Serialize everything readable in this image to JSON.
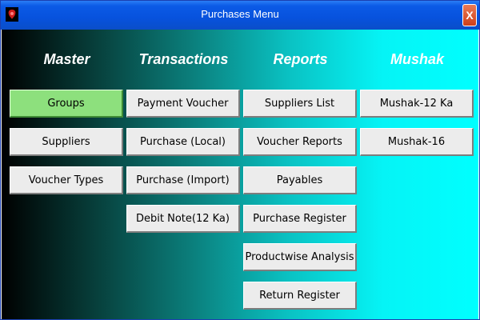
{
  "window": {
    "title": "Purchases Menu",
    "close_label": "X"
  },
  "columns": {
    "master": {
      "header": "Master",
      "items": [
        {
          "label": "Groups",
          "selected": true
        },
        {
          "label": "Suppliers"
        },
        {
          "label": "Voucher Types"
        }
      ]
    },
    "transactions": {
      "header": "Transactions",
      "items": [
        {
          "label": "Payment Voucher"
        },
        {
          "label": "Purchase (Local)"
        },
        {
          "label": "Purchase (Import)"
        },
        {
          "label": "Debit Note(12 Ka)"
        }
      ]
    },
    "reports": {
      "header": "Reports",
      "items": [
        {
          "label": "Suppliers List"
        },
        {
          "label": "Voucher Reports"
        },
        {
          "label": "Payables"
        },
        {
          "label": "Purchase Register"
        },
        {
          "label": "Productwise Analysis"
        },
        {
          "label": "Return Register"
        }
      ]
    },
    "mushak": {
      "header": "Mushak",
      "items": [
        {
          "label": "Mushak-12 Ka"
        },
        {
          "label": "Mushak-16"
        }
      ]
    }
  },
  "colors": {
    "titlebar": "#0752dd",
    "button_face": "#ececec",
    "selected_button": "#8de07d",
    "header_text": "#ffffff"
  }
}
